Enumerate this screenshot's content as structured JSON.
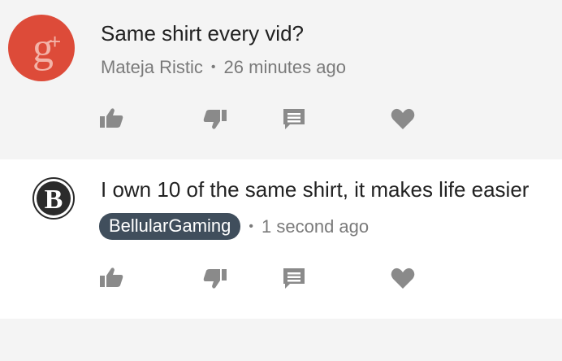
{
  "comments": [
    {
      "text": "Same shirt every vid?",
      "author": "Mateja Ristic",
      "separator": "•",
      "time": "26 minutes ago",
      "avatar_icon": "google-plus-logo",
      "avatar_color": "#dd4b39"
    },
    {
      "text": "I own 10 of the same shirt, it makes life easier",
      "author": "BellularGaming",
      "separator": "•",
      "time": "1 second ago",
      "avatar_icon": "bellular-logo",
      "avatar_letter": "B",
      "avatar_color": "#2b2b2b",
      "badge_color": "#404e5c"
    }
  ],
  "actions": {
    "icons": [
      "thumbs-up-icon",
      "thumbs-down-icon",
      "reply-icon",
      "heart-icon"
    ],
    "icon_color": "#8a8a8a"
  }
}
